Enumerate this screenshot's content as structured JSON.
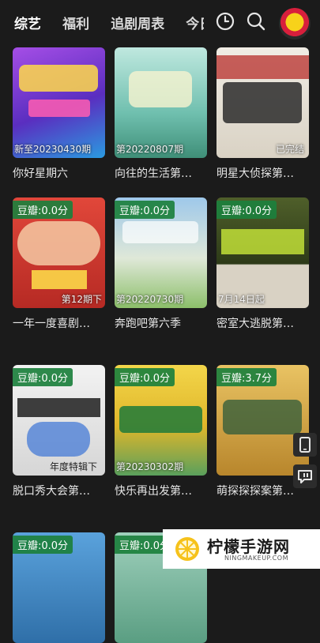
{
  "tabs": [
    {
      "label": "综艺",
      "active": true
    },
    {
      "label": "福利",
      "active": false
    },
    {
      "label": "追剧周表",
      "active": false
    },
    {
      "label": "今日",
      "active": false
    }
  ],
  "header_icons": [
    "history-icon",
    "search-icon",
    "avatar"
  ],
  "cards": [
    {
      "title": "你好星期六",
      "episode": "新至20230430期",
      "tag": "",
      "bg": "#7a3fc9"
    },
    {
      "title": "向往的生活第…",
      "episode": "第20220807期",
      "tag": "",
      "bg": "#78c7b8"
    },
    {
      "title": "明星大侦探第…",
      "episode": "已完结",
      "tag": "",
      "bg": "#e8e3da"
    },
    {
      "title": "一年一度喜剧…",
      "episode": "第12期下",
      "tag": "豆瓣:0.0分",
      "bg": "#d8382b"
    },
    {
      "title": "奔跑吧第六季",
      "episode": "第20220730期",
      "tag": "豆瓣:0.0分",
      "bg": "#7fb2db"
    },
    {
      "title": "密室大逃脱第…",
      "episode": "7月14日起",
      "tag": "豆瓣:0.0分",
      "bg": "#3a4a22"
    },
    {
      "title": "脱口秀大会第…",
      "episode": "年度特辑下",
      "tag": "豆瓣:0.0分",
      "bg": "#e8e8e8"
    },
    {
      "title": "快乐再出发第…",
      "episode": "第20230302期",
      "tag": "豆瓣:0.0分",
      "bg": "#e6c93a"
    },
    {
      "title": "萌探探探案第…",
      "episode": "",
      "tag": "豆瓣:3.7分",
      "bg": "#d4a441"
    },
    {
      "title": "",
      "episode": "",
      "tag": "豆瓣:0.0分",
      "bg": "#4e8fc9"
    },
    {
      "title": "",
      "episode": "",
      "tag": "豆瓣:0.0分",
      "bg": "#7db6a0"
    }
  ],
  "float_buttons": [
    "phone-icon",
    "message-icon"
  ],
  "watermark": {
    "name": "柠檬手游网",
    "url": "NINGMAKEUP.COM"
  }
}
